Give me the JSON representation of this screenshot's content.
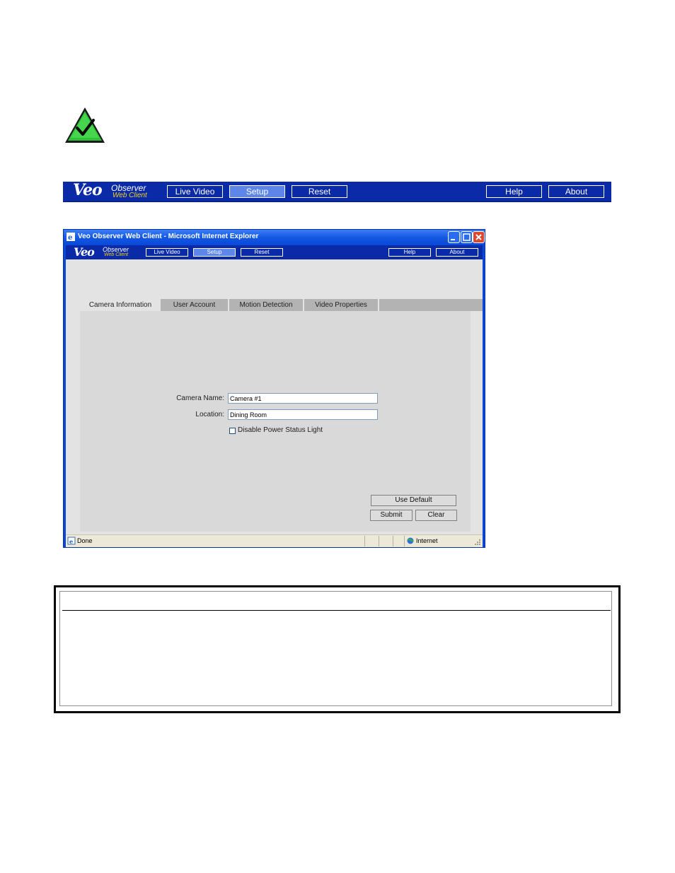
{
  "logo": {
    "veo": "Veo",
    "observer": "Observer",
    "web_client": "Web Client"
  },
  "toolbar": {
    "live_video": "Live Video",
    "setup": "Setup",
    "reset": "Reset",
    "help": "Help",
    "about": "About",
    "active_item": "Setup",
    "bar_color": "#0b2aa7",
    "active_color": "#5d86e8"
  },
  "browser": {
    "title": "Veo Observer Web Client - Microsoft Internet Explorer",
    "status_text": "Done",
    "zone": "Internet"
  },
  "tabs": [
    {
      "label": "Camera Information",
      "active": true
    },
    {
      "label": "User Account",
      "active": false
    },
    {
      "label": "Motion Detection",
      "active": false
    },
    {
      "label": "Video Properties",
      "active": false
    }
  ],
  "form": {
    "camera_name_label": "Camera Name:",
    "camera_name_value": "Camera #1",
    "location_label": "Location:",
    "location_value": "Dining Room",
    "disable_light_label": "Disable Power Status Light",
    "disable_light_checked": false
  },
  "buttons": {
    "use_default": "Use Default",
    "submit": "Submit",
    "clear": "Clear"
  },
  "icons": {
    "check": "check-icon",
    "ie": "ie-icon",
    "internet_zone": "globe-icon"
  }
}
